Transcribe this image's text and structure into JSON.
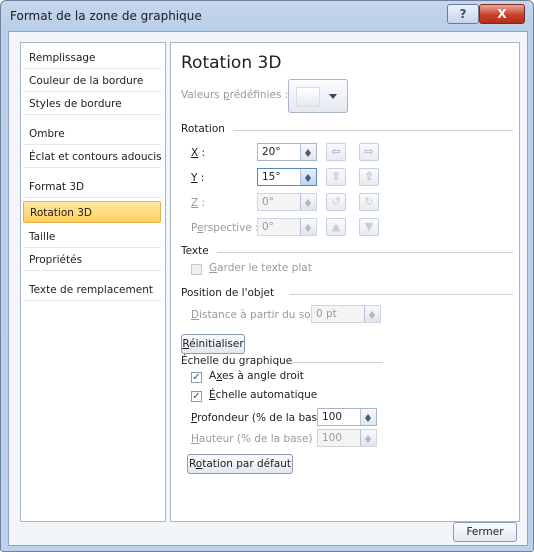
{
  "window": {
    "title": "Format de la zone de graphique",
    "help_label": "?",
    "close_label": "X"
  },
  "nav": {
    "items": [
      {
        "label": "Remplissage"
      },
      {
        "label": "Couleur de la bordure"
      },
      {
        "label": "Styles de bordure"
      },
      {
        "label": "Ombre"
      },
      {
        "label": "Éclat et contours adoucis"
      },
      {
        "label": "Format 3D"
      },
      {
        "label": "Rotation 3D",
        "active": true
      },
      {
        "label": "Taille"
      },
      {
        "label": "Propriétés"
      },
      {
        "label": "Texte de remplacement"
      }
    ]
  },
  "panel": {
    "title": "Rotation 3D",
    "presets": {
      "label_pre": "Valeurs ",
      "label_key": "p",
      "label_post": "rédéfinies :"
    },
    "rotation": {
      "group": "Rotation",
      "x": {
        "key": "X",
        "rest": " :",
        "value": "20°"
      },
      "y": {
        "key": "Y",
        "rest": " :",
        "value": "15°"
      },
      "z": {
        "key": "Z",
        "rest": " :",
        "value": "0°"
      },
      "perspective": {
        "pre": "P",
        "key": "e",
        "rest": "rspective :",
        "value": "0°"
      }
    },
    "text": {
      "group": "Texte",
      "flat_key": "G",
      "flat_rest": "arder le texte plat"
    },
    "position": {
      "group": "Position de l'objet",
      "distance_key": "D",
      "distance_rest": "istance à partir du sol :",
      "distance_value": "0 pt"
    },
    "reset": {
      "key": "R",
      "rest": "éinitialiser"
    },
    "scale": {
      "group": "Échelle du graphique",
      "axes_pre": "A",
      "axes_key": "x",
      "axes_rest": "es à angle droit",
      "axes_checked": true,
      "auto_key": "É",
      "auto_rest": "chelle automatique",
      "auto_checked": true,
      "depth_key": "P",
      "depth_rest": "rofondeur (% de la base)",
      "depth_value": "100",
      "height_key": "H",
      "height_rest": "auteur (% de la base)",
      "height_value": "100",
      "default_pre": "R",
      "default_key": "o",
      "default_rest": "tation par défaut"
    }
  },
  "footer": {
    "close_label": "Fermer"
  },
  "icons": {
    "x_left": "rotate-left-icon",
    "x_right": "rotate-right-icon",
    "y_up": "tilt-up-icon",
    "y_down": "tilt-down-icon",
    "z_ccw": "rotate-ccw-icon",
    "z_cw": "rotate-cw-icon",
    "persp_narrow": "perspective-narrow-icon",
    "persp_widen": "perspective-widen-icon"
  }
}
